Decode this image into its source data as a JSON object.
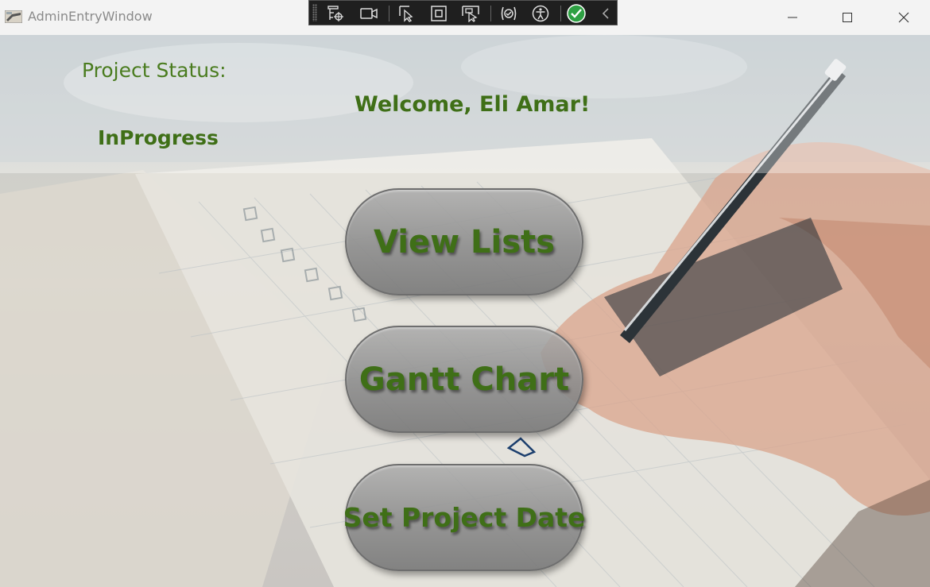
{
  "window": {
    "title": "AdminEntryWindow",
    "controls": {
      "minimize": "minimize",
      "maximize": "maximize",
      "close": "close"
    }
  },
  "debug_toolbar": {
    "icons": [
      "live-visual-tree-icon",
      "record-icon",
      "select-element-icon",
      "display-adorners-icon",
      "track-focus-icon",
      "binding-failures-icon",
      "accessibility-icon",
      "hot-reload-ok-icon",
      "collapse-icon"
    ],
    "status_color": "#2ea043"
  },
  "header": {
    "project_status_label": "Project Status:",
    "project_status_value": "InProgress",
    "welcome": "Welcome, Eli Amar!"
  },
  "buttons": {
    "view_lists": "View Lists",
    "gantt_chart": "Gantt Chart",
    "set_project_date": "Set Project Date"
  },
  "colors": {
    "text_green": "#3f6f17",
    "button_gray": "#8c8c8c"
  }
}
